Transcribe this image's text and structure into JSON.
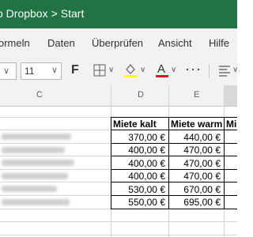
{
  "titlebar": {
    "app": "o Dropbox",
    "separator": ">",
    "page": "Start"
  },
  "menu": {
    "formulas": "ormeln",
    "data": "Daten",
    "review": "Überprüfen",
    "view": "Ansicht",
    "help": "Hilfe"
  },
  "toolbar": {
    "font_size": "11",
    "bold": "F"
  },
  "columns": [
    "C",
    "D",
    "E"
  ],
  "sheet": {
    "headers": {
      "d": "Miete kalt",
      "e": "Miete warm",
      "f": "Mi"
    },
    "rows": [
      {
        "d": "370,00 €",
        "e": "440,00 €"
      },
      {
        "d": "400,00 €",
        "e": "470,00 €"
      },
      {
        "d": "400,00 €",
        "e": "470,00 €"
      },
      {
        "d": "400,00 €",
        "e": "470,00 €"
      },
      {
        "d": "530,00 €",
        "e": "670,00 €"
      },
      {
        "d": "550,00 €",
        "e": "695,00 €"
      }
    ]
  },
  "colors": {
    "brand": "#217346",
    "font_red": "#e81123",
    "highlight_yellow": "#ffff00"
  },
  "icons": [
    "chevron-down-icon",
    "borders-icon",
    "fill-color-icon",
    "font-color-icon",
    "more-icon",
    "align-icon"
  ]
}
